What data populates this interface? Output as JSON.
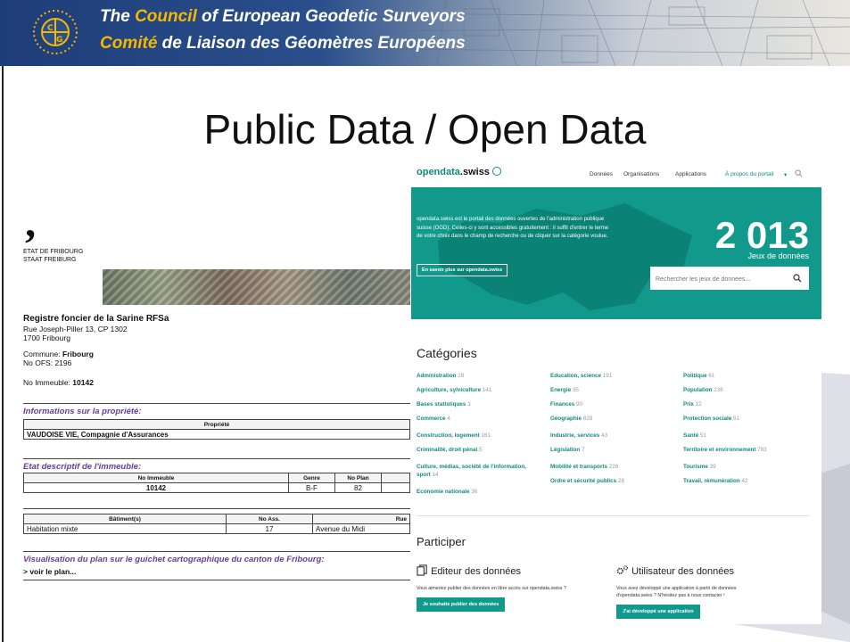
{
  "banner": {
    "title_line1_prefix": "The ",
    "title_line1_highlight": "Council",
    "title_line1_suffix": " of European Geodetic Surveyors",
    "title_line2_highlight": "Comité",
    "title_line2_suffix": " de Liaison des Géomètres Européens",
    "logo_icon": "ceges-logo-icon"
  },
  "slide": {
    "title": "Public Data / Open Data"
  },
  "fribourg_doc": {
    "mark": "‚",
    "etat_line1": "ETAT DE FRIBOURG",
    "etat_line2": "STAAT FREIBURG",
    "registry_name": "Registre foncier de la Sarine RFSa",
    "address_line1": "Rue Joseph-Piller 13, CP 1302",
    "address_line2": "1700 Fribourg",
    "commune_label": "Commune:",
    "commune_value": "Fribourg",
    "ofs_label": "No OFS:",
    "ofs_value": "2196",
    "immeuble_label": "No Immeuble:",
    "immeuble_value": "10142",
    "section1_title": "Informations sur la propriété:",
    "section1_col": "Propriété",
    "section1_value": "VAUDOISE VIE, Compagnie d'Assurances",
    "section2_title": "Etat descriptif de l'immeuble:",
    "section2_cols": [
      "No Immeuble",
      "Genre",
      "No Plan"
    ],
    "section2_row": [
      "10142",
      "B-F",
      "82"
    ],
    "section3_cols": [
      "Bâtiment(s)",
      "No Ass.",
      "Rue"
    ],
    "section3_row": [
      "Habitation mixte",
      "17",
      "Avenue du Midi"
    ],
    "section4_title": "Visualisation du plan sur le guichet cartographique du canton de Fribourg:",
    "section4_link": "> voir le plan..."
  },
  "opendata": {
    "logo_main": "opendata",
    "logo_suffix": ".swiss",
    "nav": [
      "Données",
      "Organisations",
      "Applications",
      "À propos du portail"
    ],
    "nav_dropdown_icon": "chevron-down-icon",
    "hero_text": "opendata.swiss est le portail des données ouvertes de l'administration publique suisse (OGD). Celles-ci y sont accessibles gratuitement : il suffit d'entrer le terme de votre choix dans le champ de recherche ou de cliquer sur la catégorie voulue.",
    "hero_button": "En savoir plus sur opendata.swiss",
    "count": "2 013",
    "count_label": "Jeux de données",
    "search_placeholder": "Rechercher les jeux de données...",
    "categories_title": "Catégories",
    "categories_col1": [
      {
        "label": "Administration",
        "n": "28"
      },
      {
        "label": "Agriculture, sylviculture",
        "n": "141"
      },
      {
        "label": "Bases statistiques",
        "n": "3"
      },
      {
        "label": "Commerce",
        "n": "4"
      },
      {
        "label": "Construction, logement",
        "n": "161"
      },
      {
        "label": "Criminalité, droit pénal",
        "n": "5"
      },
      {
        "label": "Culture, médias, société de l'information,",
        "n": ""
      },
      {
        "label": "sport",
        "n": "14"
      },
      {
        "label": "Economie nationale",
        "n": "36"
      }
    ],
    "categories_col2": [
      {
        "label": "Education, science",
        "n": "191"
      },
      {
        "label": "Energie",
        "n": "35"
      },
      {
        "label": "Finances",
        "n": "90"
      },
      {
        "label": "Géographie",
        "n": "828"
      },
      {
        "label": "Industrie, services",
        "n": "43"
      },
      {
        "label": "Législation",
        "n": "7"
      },
      {
        "label": "Mobilité et transports",
        "n": "226"
      },
      {
        "label": "Ordre et sécurité publics",
        "n": "28"
      }
    ],
    "categories_col3": [
      {
        "label": "Politique",
        "n": "61"
      },
      {
        "label": "Population",
        "n": "236"
      },
      {
        "label": "Prix",
        "n": "12"
      },
      {
        "label": "Protection sociale",
        "n": "51"
      },
      {
        "label": "Santé",
        "n": "51"
      },
      {
        "label": "Territoire et environnement",
        "n": "783"
      },
      {
        "label": "Tourisme",
        "n": "39"
      },
      {
        "label": "Travail, rémunération",
        "n": "42"
      }
    ],
    "participer_title": "Participer",
    "editor_title": "Editeur des données",
    "editor_text": "Vous aimeriez publier des données en libre accès sur opendata.swiss ?",
    "editor_button": "Je souhaite publier des données",
    "user_title": "Utilisateur des données",
    "user_text1": "Vous avez développé une application à partir de données",
    "user_text2": "d'opendata.swiss ? N'hésitez pas à nous contacter !",
    "user_button": "J'ai développé une application"
  },
  "colors": {
    "banner_blue": "#1e3d78",
    "highlight": "#f5b800",
    "opendata_teal": "#119a8b",
    "section_purple": "#6a3ba0"
  }
}
